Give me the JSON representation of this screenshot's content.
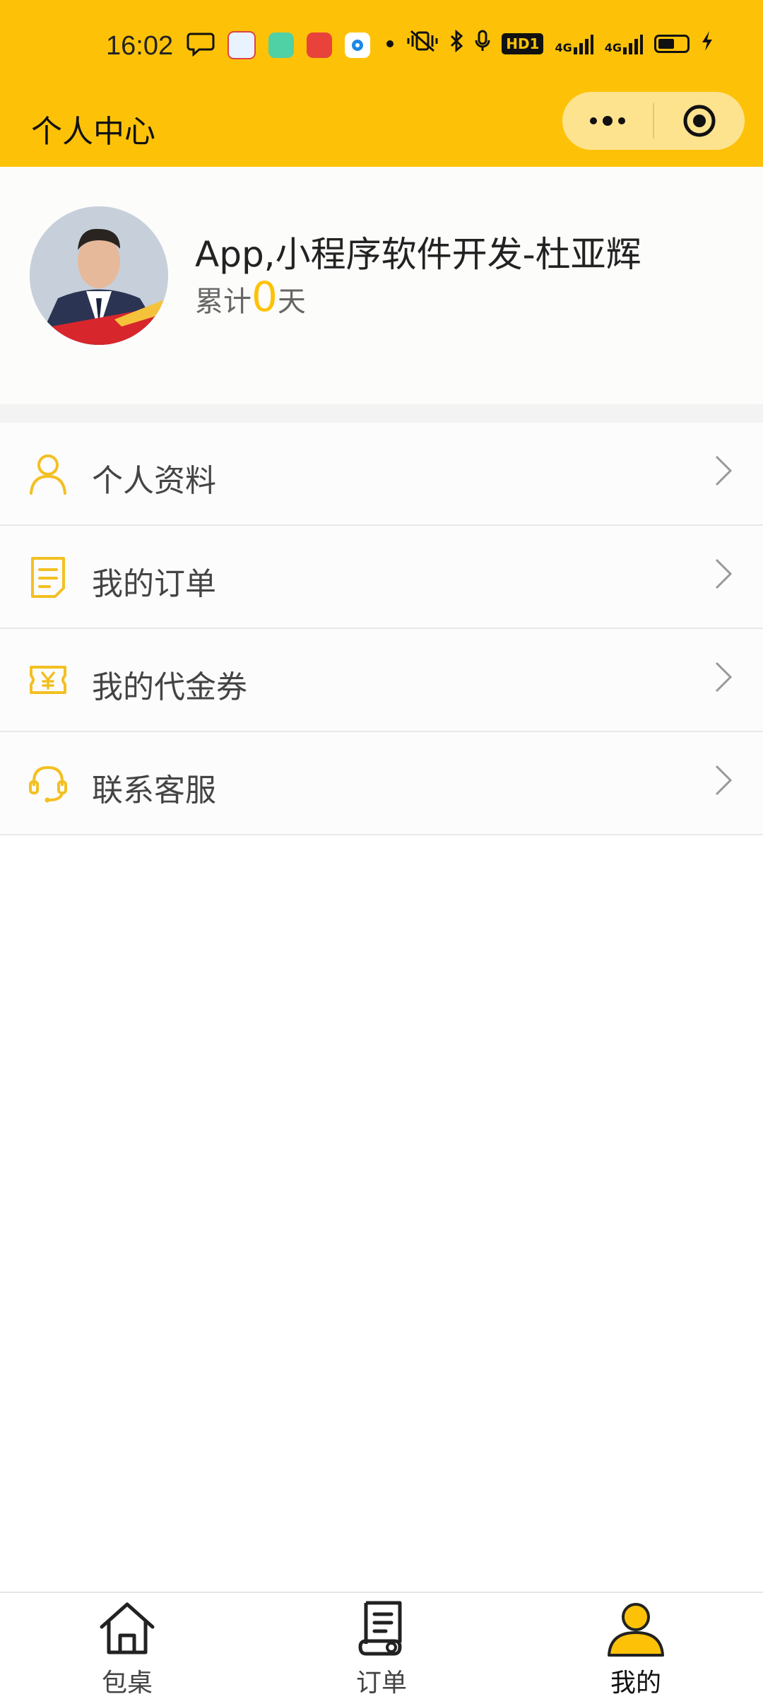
{
  "status_bar": {
    "time": "16:02",
    "hd": "HD1",
    "network_1": "4G",
    "network_2": "4G",
    "icons": [
      "chat-bubble-icon",
      "app-notification-icon",
      "app-notification-icon",
      "app-notification-icon",
      "app-notification-icon",
      "dot-icon",
      "vibrate-icon",
      "bluetooth-icon",
      "mic-icon",
      "hd-icon",
      "signal-icon",
      "signal-icon",
      "battery-icon",
      "charging-icon"
    ]
  },
  "nav": {
    "title": "个人中心",
    "more_icon": "more-dots-icon",
    "close_icon": "target-close-icon"
  },
  "profile": {
    "name": "App,小程序软件开发-杜亚辉",
    "days_prefix": "累计",
    "days_value": "0",
    "days_suffix": "天"
  },
  "menu": [
    {
      "label": "个人资料",
      "icon": "person-icon"
    },
    {
      "label": "我的订单",
      "icon": "order-list-icon"
    },
    {
      "label": "我的代金券",
      "icon": "voucher-icon"
    },
    {
      "label": "联系客服",
      "icon": "headset-icon"
    }
  ],
  "tabs": [
    {
      "label": "包桌",
      "icon": "home-icon"
    },
    {
      "label": "订单",
      "icon": "order-scroll-icon"
    },
    {
      "label": "我的",
      "icon": "user-icon"
    }
  ],
  "colors": {
    "accent": "#fdc208",
    "text": "#444444"
  }
}
